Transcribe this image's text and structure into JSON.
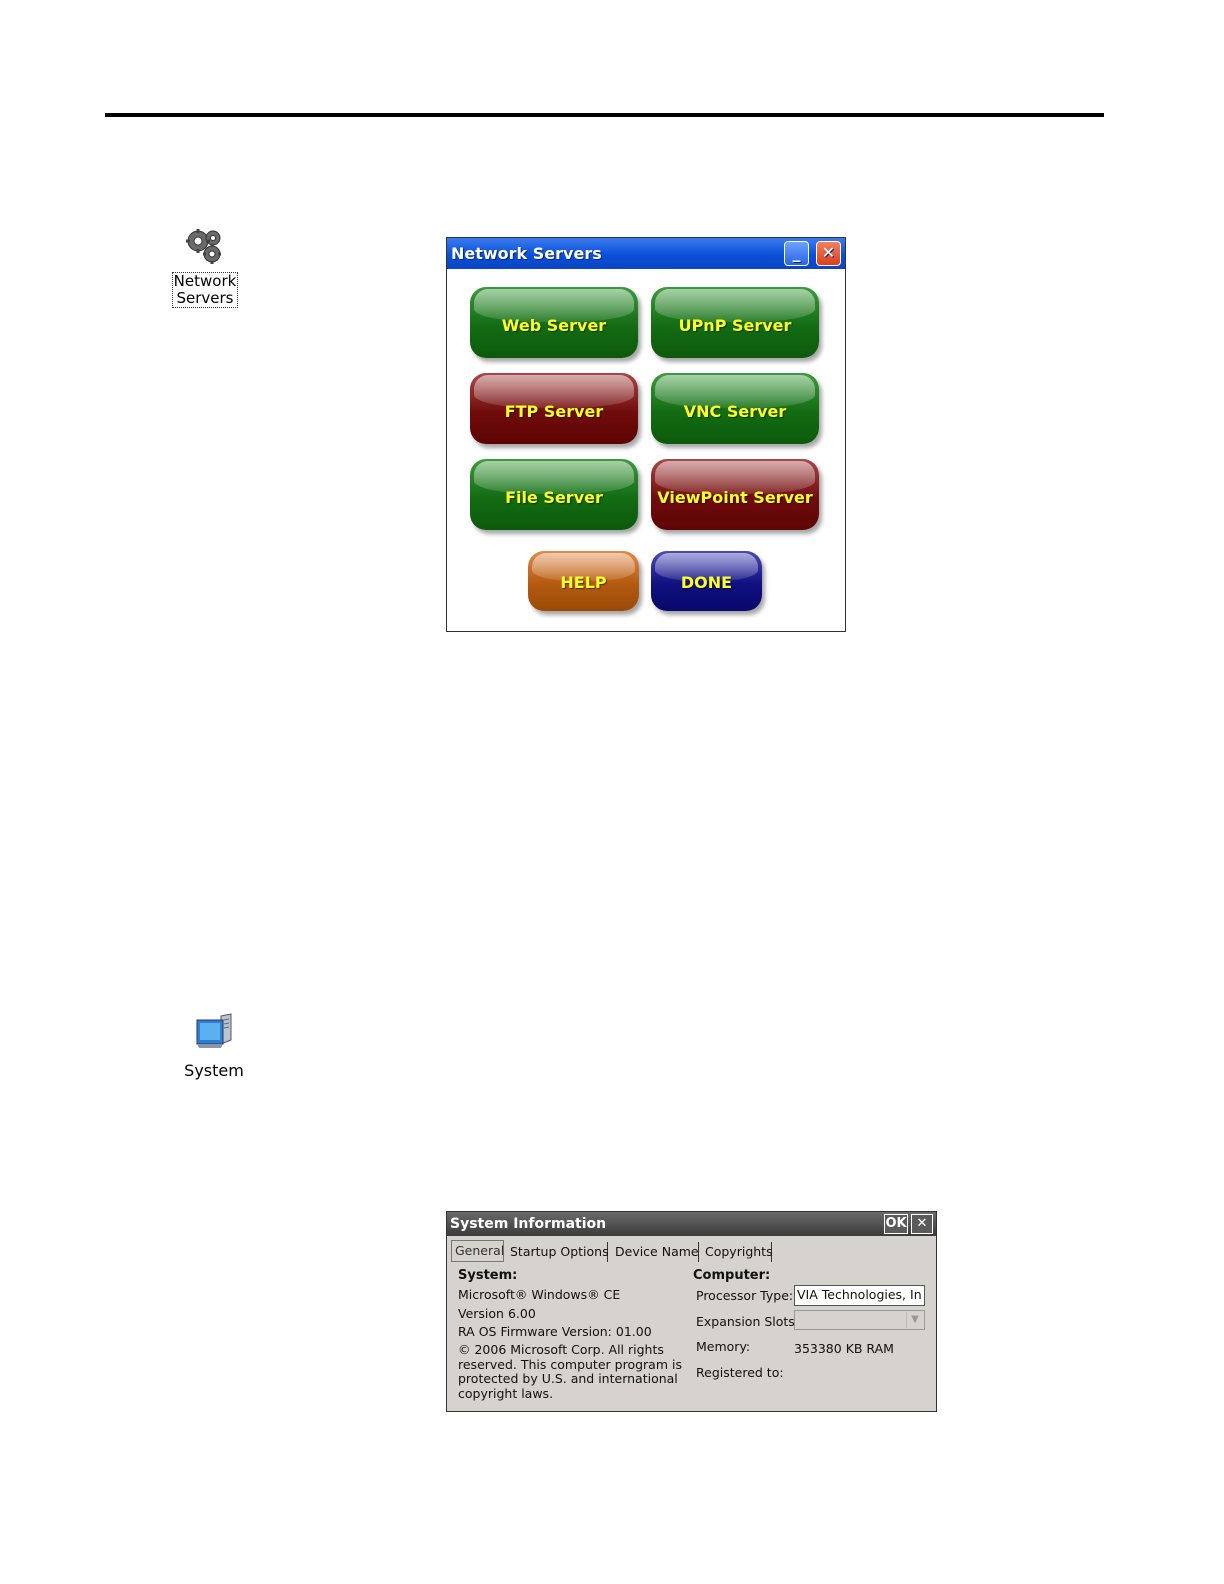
{
  "network_icon": {
    "label_line1": "Network",
    "label_line2": "Servers"
  },
  "system_icon": {
    "label": "System"
  },
  "network_window": {
    "title": "Network Servers",
    "buttons": {
      "web": "Web Server",
      "upnp": "UPnP Server",
      "ftp": "FTP Server",
      "vnc": "VNC Server",
      "file": "File Server",
      "viewpoint": "ViewPoint Server",
      "help": "HELP",
      "done": "DONE"
    }
  },
  "system_window": {
    "title": "System Information",
    "ok": "OK",
    "tabs": [
      "General",
      "Startup Options",
      "Device Name",
      "Copyrights"
    ],
    "system": {
      "heading": "System:",
      "os": "Microsoft® Windows® CE",
      "version": "Version 6.00",
      "firmware": "RA OS Firmware Version: 01.00",
      "copyright1": "© 2006 Microsoft Corp. All rights",
      "copyright2": "reserved. This computer program is",
      "copyright3": "protected by U.S. and international",
      "copyright4": "copyright laws."
    },
    "computer": {
      "heading": "Computer:",
      "processor_label": "Processor Type:",
      "processor_value": "VIA Technologies, In",
      "slots_label": "Expansion Slots:",
      "memory_label": "Memory:",
      "memory_value": "353380 KB  RAM",
      "registered_label": "Registered to:"
    }
  }
}
